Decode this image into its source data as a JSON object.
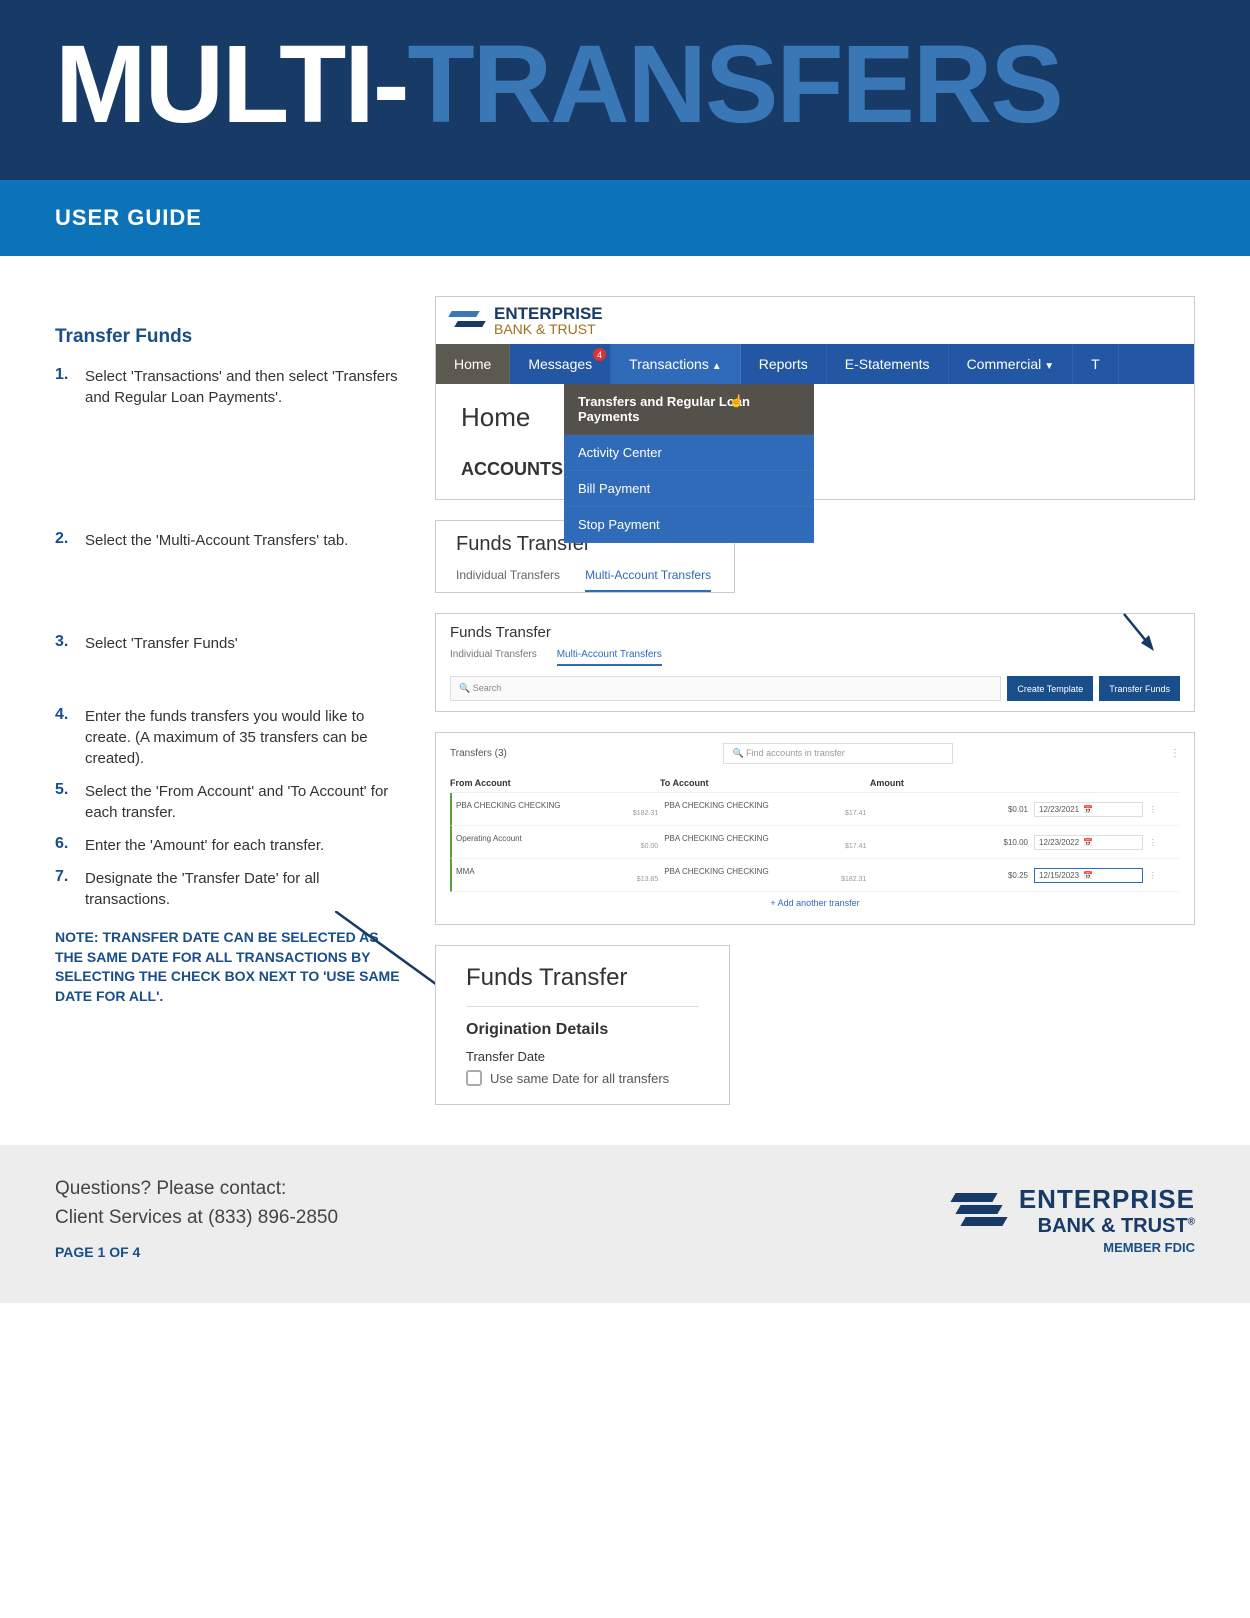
{
  "header": {
    "title_part1": "MULTI-",
    "title_part2": "TRANSFERS",
    "subtitle": "USER GUIDE"
  },
  "section": {
    "title": "Transfer Funds",
    "note": "NOTE: TRANSFER DATE CAN BE SELECTED AS THE SAME DATE FOR ALL TRANSACTIONS BY SELECTING THE CHECK BOX NEXT TO 'USE SAME DATE FOR ALL'."
  },
  "steps": [
    "Select 'Transactions' and then select 'Transfers and Regular Loan Payments'.",
    "Select the 'Multi-Account Transfers' tab.",
    "Select 'Transfer Funds'",
    "Enter the funds transfers you would like to create. (A maximum of 35 transfers can be created).",
    "Select the 'From Account' and 'To Account' for each transfer.",
    "Enter the 'Amount' for each transfer.",
    "Designate the 'Transfer Date' for all transactions."
  ],
  "ss1": {
    "logo_top": "ENTERPRISE",
    "logo_bottom": "BANK & TRUST",
    "nav": {
      "home": "Home",
      "messages": "Messages",
      "badge": "4",
      "transactions": "Transactions",
      "reports": "Reports",
      "estatements": "E-Statements",
      "commercial": "Commercial",
      "tail": "T"
    },
    "body_home": "Home",
    "body_accounts": "ACCOUNTS",
    "dropdown": [
      "Transfers and Regular Loan Payments",
      "Activity Center",
      "Bill Payment",
      "Stop Payment"
    ]
  },
  "ss2": {
    "title": "Funds Transfer",
    "tab1": "Individual Transfers",
    "tab2": "Multi-Account Transfers"
  },
  "ss3": {
    "title": "Funds Transfer",
    "tab1": "Individual Transfers",
    "tab2": "Multi-Account Transfers",
    "search_placeholder": "Search",
    "btn_template": "Create Template",
    "btn_transfer": "Transfer Funds"
  },
  "ss4": {
    "header": "Transfers (3)",
    "search_placeholder": "Find accounts in transfer",
    "col_from": "From Account",
    "col_to": "To Account",
    "col_amount": "Amount",
    "rows": [
      {
        "from_name": "PBA CHECKING CHECKING",
        "from_sub": "",
        "from_bal": "$182.31",
        "to_name": "PBA CHECKING CHECKING",
        "to_sub": "",
        "to_bal": "$17.41",
        "amount": "$0.01",
        "date": "12/23/2021"
      },
      {
        "from_name": "Operating Account",
        "from_sub": "",
        "from_bal": "$0.00",
        "to_name": "PBA CHECKING CHECKING",
        "to_sub": "",
        "to_bal": "$17.41",
        "amount": "$10.00",
        "date": "12/23/2022"
      },
      {
        "from_name": "MMA",
        "from_sub": "",
        "from_bal": "$13.85",
        "to_name": "PBA CHECKING CHECKING",
        "to_sub": "",
        "to_bal": "$182.31",
        "amount": "$0.25",
        "date": "12/15/2023"
      }
    ],
    "add": "+ Add another transfer"
  },
  "ss5": {
    "title": "Funds Transfer",
    "section": "Origination Details",
    "label": "Transfer Date",
    "checkbox": "Use same Date for all transfers"
  },
  "footer": {
    "contact1": "Questions? Please contact:",
    "contact2": "Client Services at (833) 896-2850",
    "page": "PAGE 1 OF 4",
    "logo_top": "ENTERPRISE",
    "logo_bottom": "BANK & TRUST",
    "member": "MEMBER FDIC"
  }
}
